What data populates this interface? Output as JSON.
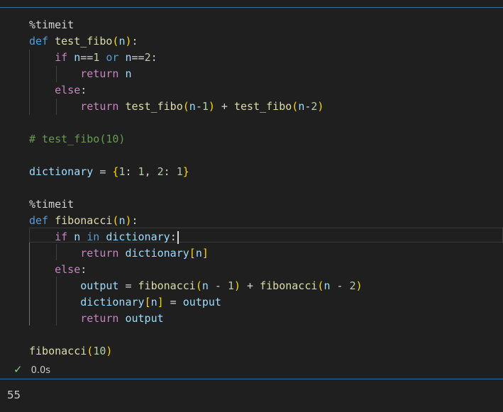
{
  "cell": {
    "magic_1": "%timeit",
    "def_kw": "def",
    "fn1_name": "test_fibo",
    "param_n": "n",
    "if_kw": "if",
    "or_kw": "or",
    "return_kw": "return",
    "else_kw": "else",
    "in_kw": "in",
    "num_1": "1",
    "num_2": "2",
    "num_10": "10",
    "comment": "# test_fibo(10)",
    "dict_name": "dictionary",
    "magic_2": "%timeit",
    "fn2_name": "fibonacci",
    "output_var": "output"
  },
  "status": {
    "check_icon": "✓",
    "time": "0.0s"
  },
  "output": {
    "value": "55"
  },
  "colors": {
    "background": "#1f1f1f",
    "keyword": "#569cd6",
    "control": "#c586c0",
    "function": "#dcdcaa",
    "variable": "#9cdcfe",
    "number": "#b5cea8",
    "comment": "#6a9955",
    "accent_border": "#2b6ea8",
    "success": "#89d185"
  }
}
